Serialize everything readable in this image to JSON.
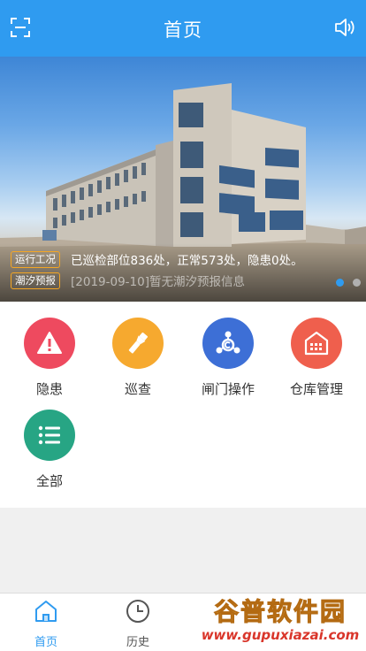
{
  "header": {
    "title": "首页"
  },
  "banner": {
    "notices": [
      {
        "tag": "运行工况",
        "text": "已巡检部位836处，正常573处，隐患0处。"
      },
      {
        "tag": "潮汐预报",
        "text": "[2019-09-10]暂无潮汐预报信息"
      }
    ],
    "page_count": 2,
    "active_page": 1
  },
  "menu": {
    "items": [
      {
        "label": "隐患",
        "icon": "warning-icon",
        "color": "#ee4a5f"
      },
      {
        "label": "巡查",
        "icon": "flashlight-icon",
        "color": "#f6a92f"
      },
      {
        "label": "闸门操作",
        "icon": "gate-operation-icon",
        "color": "#3d6fd6"
      },
      {
        "label": "仓库管理",
        "icon": "warehouse-icon",
        "color": "#ef5f4d"
      },
      {
        "label": "全部",
        "icon": "list-icon",
        "color": "#27a584"
      }
    ]
  },
  "tabbar": {
    "tabs": [
      {
        "label": "首页",
        "icon": "home-icon",
        "active": true
      },
      {
        "label": "历史",
        "icon": "clock-icon",
        "active": false
      }
    ]
  },
  "watermark": {
    "line1": "谷普软件园",
    "line2": "www.gupuxiazai.com"
  },
  "colors": {
    "primary": "#2f9bf0",
    "tag_border": "#f5a623"
  }
}
